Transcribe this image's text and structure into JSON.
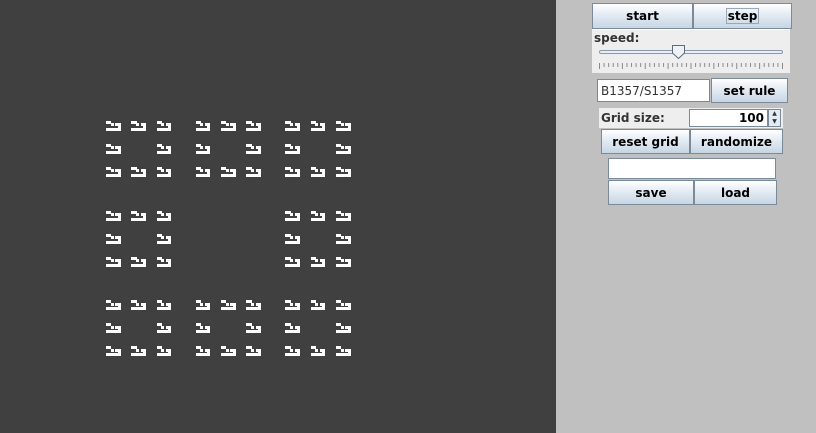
{
  "app": {
    "controls": {
      "start_label": "start",
      "step_label": "step",
      "speed_label": "speed:",
      "speed_value_fraction": 0.43,
      "rule_value": "B1357/S1357",
      "set_rule_label": "set rule",
      "grid_size_label": "Grid size:",
      "grid_size_value": "100",
      "reset_grid_label": "reset grid",
      "randomize_label": "randomize",
      "file_name_value": "",
      "save_label": "save",
      "load_label": "load"
    },
    "colors": {
      "canvas_background": "#404040",
      "live_cell": "#ffffff",
      "panel_background": "#c0c0c0"
    },
    "icons": {
      "spinner_up": "up-arrow-icon",
      "spinner_down": "down-arrow-icon",
      "slider_thumb": "slider-thumb-icon"
    }
  }
}
